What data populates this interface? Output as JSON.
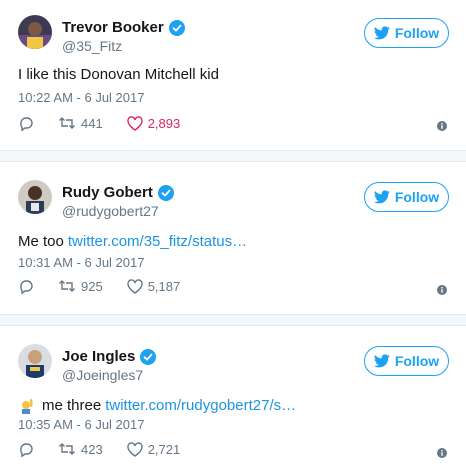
{
  "colors": {
    "accent": "#1da1f2",
    "link": "#1b95e0",
    "like_active": "#e0245e",
    "secondary_text": "#657786"
  },
  "tweets": [
    {
      "display_name": "Trevor Booker",
      "handle": "@35_Fitz",
      "follow_label": "Follow",
      "text": "I like this Donovan Mitchell kid",
      "link": "",
      "timestamp": "10:22 AM - 6 Jul 2017",
      "retweets": "441",
      "likes": "2,893",
      "liked": true
    },
    {
      "display_name": "Rudy Gobert",
      "handle": "@rudygobert27",
      "follow_label": "Follow",
      "text": "Me too",
      "link": "twitter.com/35_fitz/status…",
      "timestamp": "10:31 AM - 6 Jul 2017",
      "retweets": "925",
      "likes": "5,187",
      "liked": false
    },
    {
      "display_name": "Joe Ingles",
      "handle": "@Joeingles7",
      "follow_label": "Follow",
      "text": "me three",
      "link": "twitter.com/rudygobert27/s…",
      "timestamp": "10:35 AM - 6 Jul 2017",
      "retweets": "423",
      "likes": "2,721",
      "liked": false
    }
  ]
}
